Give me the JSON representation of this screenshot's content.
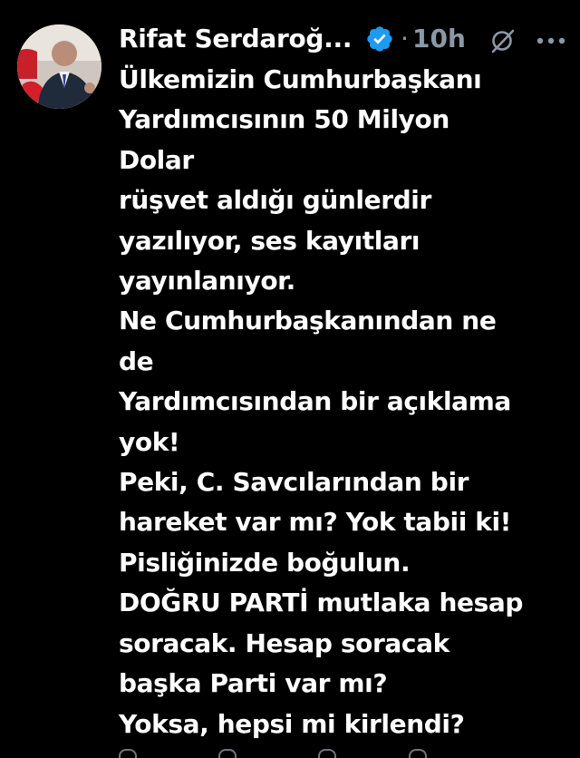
{
  "tweet": {
    "author_name": "Rifat Serdaroğ...",
    "timestamp": "10h",
    "separator": "·",
    "text": "Ülkemizin Cumhurbaşkanı\nYardımcısının 50 Milyon\nDolar\nrüşvet aldığı günlerdir\nyazılıyor, ses kayıtları\nyayınlanıyor.\nNe Cumhurbaşkanından ne\nde\nYardımcısından bir açıklama\nyok!\nPeki, C. Savcılarından bir\nhareket var mı? Yok tabii ki!\nPisliğinizde boğulun.\nDOĞRU PARTİ mutlaka hesap\nsoracak. Hesap soracak\nbaşka Parti var mı?\nYoksa, hepsi mi kirlendi?"
  },
  "icons": {
    "verified": "verified-badge-icon",
    "grok": "grok-icon",
    "more": "more-options-icon"
  },
  "colors": {
    "background": "#000000",
    "text": "#ffffff",
    "secondary_text": "#8b98a5",
    "verified_blue": "#1d9bf0"
  }
}
